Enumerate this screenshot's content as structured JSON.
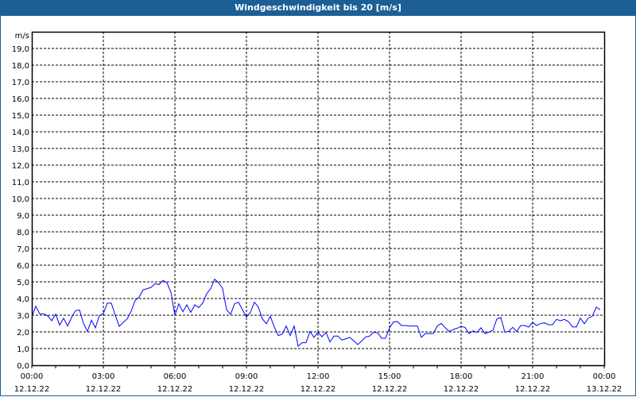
{
  "title": "Windgeschwindigkeit bis 20 [m/s]",
  "colors": {
    "header": "#1c5f96",
    "line": "#0000ff"
  },
  "chart_data": {
    "type": "line",
    "title": "Windgeschwindigkeit bis 20 [m/s]",
    "ylabel": "m/s",
    "xlabel": "",
    "ylim": [
      0,
      20
    ],
    "xlim_hours": [
      0,
      24
    ],
    "grid": true,
    "yticks": [
      "0,0",
      "1,0",
      "2,0",
      "3,0",
      "4,0",
      "5,0",
      "6,0",
      "7,0",
      "8,0",
      "9,0",
      "10,0",
      "11,0",
      "12,0",
      "13,0",
      "14,0",
      "15,0",
      "16,0",
      "17,0",
      "18,0",
      "19,0"
    ],
    "xticks": [
      {
        "time": "00:00",
        "date": "12.12.22",
        "hour": 0
      },
      {
        "time": "03:00",
        "date": "12.12.22",
        "hour": 3
      },
      {
        "time": "06:00",
        "date": "12.12.22",
        "hour": 6
      },
      {
        "time": "09:00",
        "date": "12.12.22",
        "hour": 9
      },
      {
        "time": "12:00",
        "date": "12.12.22",
        "hour": 12
      },
      {
        "time": "15:00",
        "date": "12.12.22",
        "hour": 15
      },
      {
        "time": "18:00",
        "date": "12.12.22",
        "hour": 18
      },
      {
        "time": "21:00",
        "date": "12.12.22",
        "hour": 21
      },
      {
        "time": "00:00",
        "date": "13.12.22",
        "hour": 24
      }
    ],
    "series": [
      {
        "name": "Windgeschwindigkeit",
        "start_hour": 0,
        "interval_minutes": 10,
        "values": [
          2.9,
          3.54,
          3.08,
          3.08,
          2.96,
          2.67,
          3.06,
          2.41,
          2.82,
          2.35,
          2.86,
          3.27,
          3.32,
          2.5,
          2.03,
          2.7,
          2.25,
          2.98,
          3.1,
          3.73,
          3.73,
          3.0,
          2.33,
          2.57,
          2.78,
          3.25,
          3.89,
          4.08,
          4.52,
          4.59,
          4.67,
          4.89,
          4.84,
          5.08,
          4.95,
          4.37,
          3.0,
          3.68,
          3.21,
          3.62,
          3.17,
          3.62,
          3.46,
          3.73,
          4.29,
          4.6,
          5.16,
          4.95,
          4.6,
          3.33,
          3.05,
          3.68,
          3.78,
          3.33,
          2.89,
          3.17,
          3.78,
          3.49,
          2.78,
          2.49,
          2.94,
          2.3,
          1.78,
          1.87,
          2.35,
          1.78,
          2.35,
          1.14,
          1.35,
          1.35,
          2.03,
          1.67,
          1.98,
          1.71,
          1.97,
          1.4,
          1.75,
          1.75,
          1.51,
          1.59,
          1.67,
          1.46,
          1.24,
          1.46,
          1.7,
          1.75,
          1.98,
          1.94,
          1.62,
          1.62,
          2.25,
          2.6,
          2.62,
          2.38,
          2.38,
          2.35,
          2.35,
          2.35,
          1.67,
          1.9,
          1.9,
          1.9,
          2.35,
          2.51,
          2.25,
          2.03,
          2.14,
          2.22,
          2.33,
          2.27,
          1.9,
          2.06,
          1.97,
          2.25,
          1.9,
          1.98,
          2.1,
          2.78,
          2.86,
          1.98,
          2.03,
          2.27,
          2.03,
          2.38,
          2.38,
          2.29,
          2.57,
          2.38,
          2.51,
          2.54,
          2.43,
          2.43,
          2.75,
          2.67,
          2.75,
          2.62,
          2.3,
          2.3,
          2.83,
          2.49,
          2.83,
          2.94,
          3.49,
          3.33
        ]
      }
    ]
  }
}
